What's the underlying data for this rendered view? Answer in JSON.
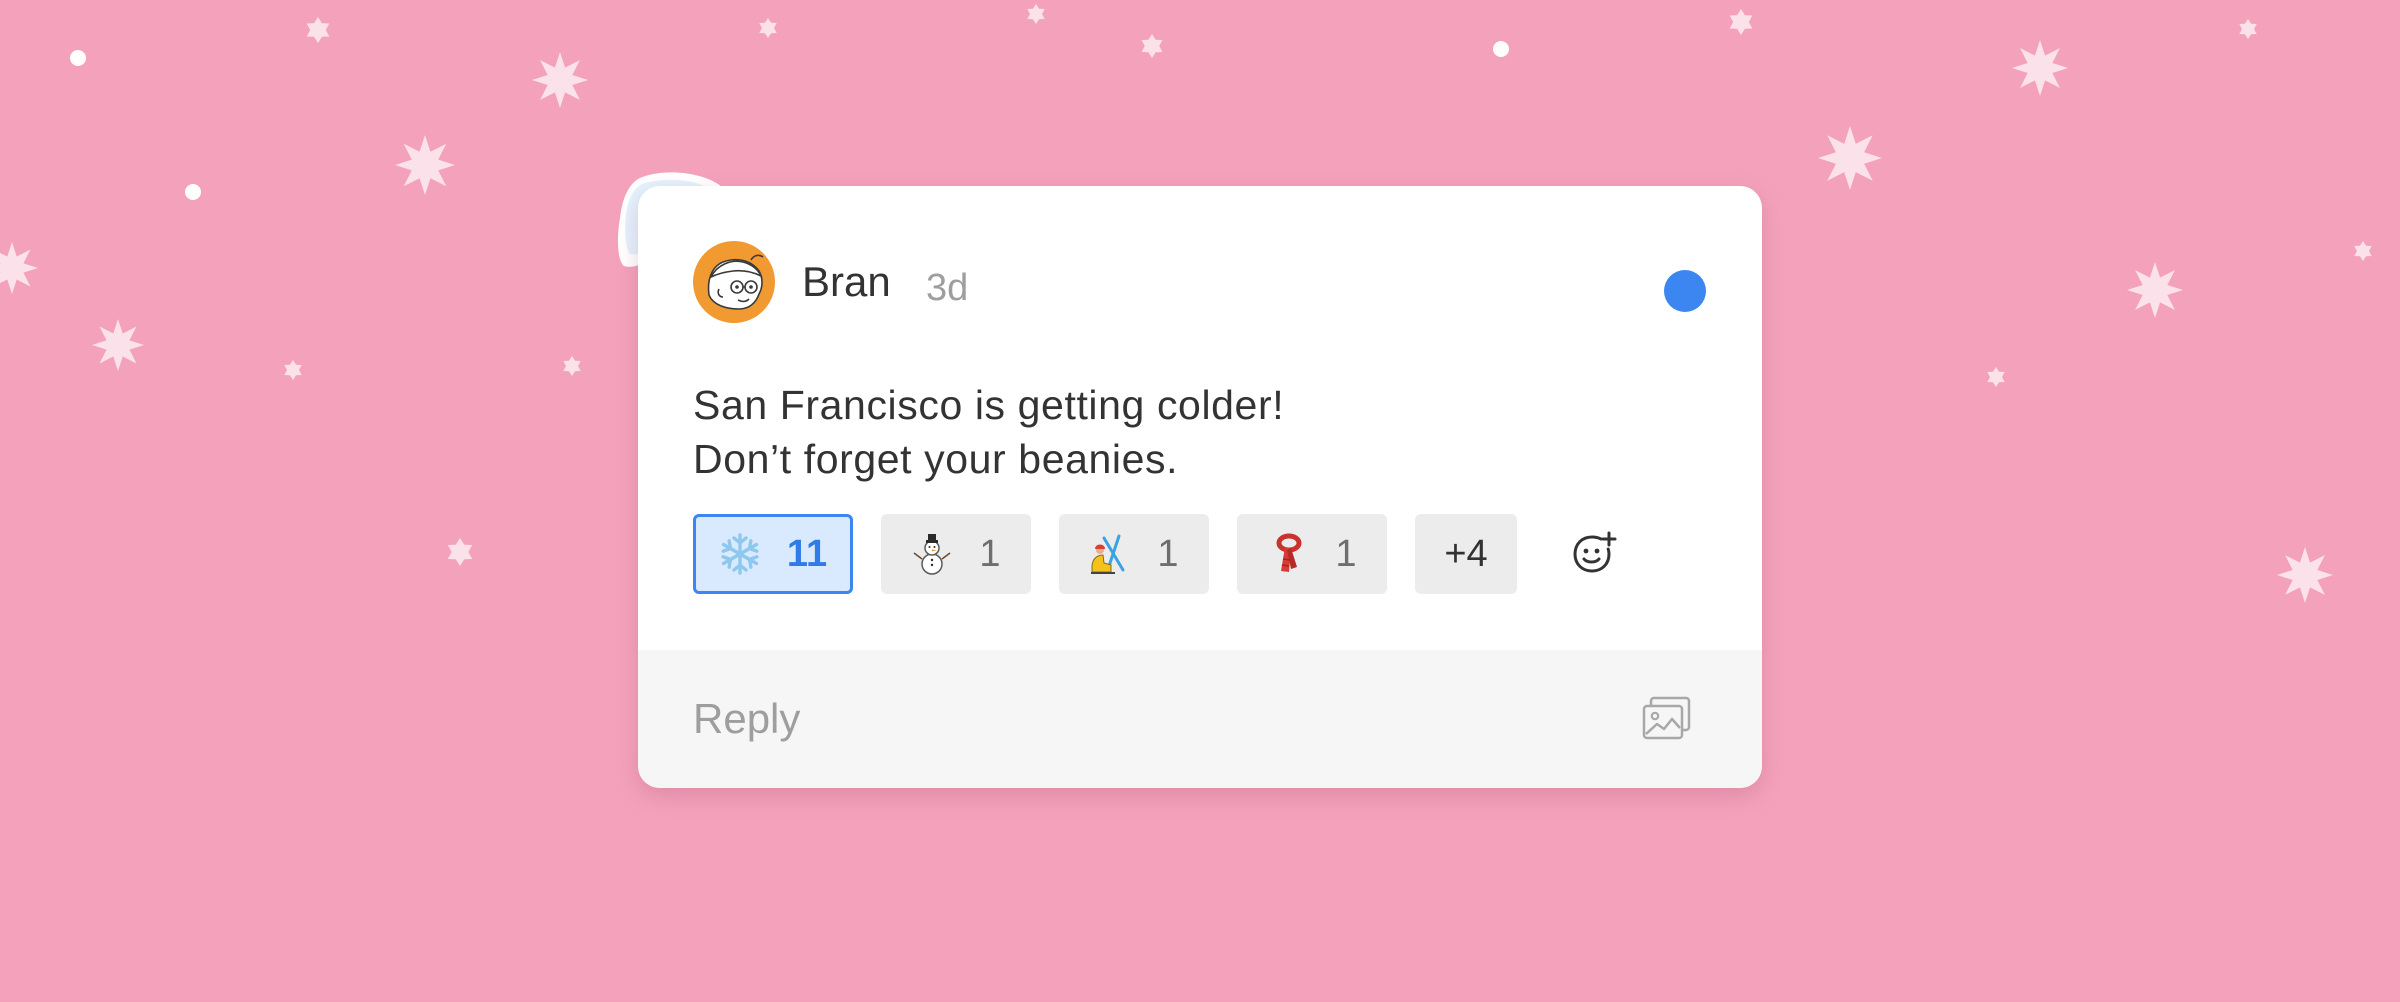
{
  "colors": {
    "background": "#f4a2bc",
    "card": "#ffffff",
    "accent_blue": "#3b86f1",
    "avatar_orange": "#f19a31",
    "reply_bar": "#f6f6f6"
  },
  "comment": {
    "author": "Bran",
    "timestamp": "3d",
    "unread_indicator_color": "#3b86f1",
    "avatar_icon": "cartoon-face-avatar",
    "message_lines": [
      "San Francisco is getting colder!",
      "Don’t forget your beanies."
    ]
  },
  "reactions": [
    {
      "emoji": "snowflake",
      "count": "11",
      "selected": true
    },
    {
      "emoji": "snowman",
      "count": "1",
      "selected": false
    },
    {
      "emoji": "skier",
      "count": "1",
      "selected": false
    },
    {
      "emoji": "scarf",
      "count": "1",
      "selected": false
    }
  ],
  "more_reactions_label": "+4",
  "add_reaction_icon": "add-emoji-icon",
  "reply": {
    "placeholder": "Reply",
    "attach_icon": "image-icon"
  }
}
